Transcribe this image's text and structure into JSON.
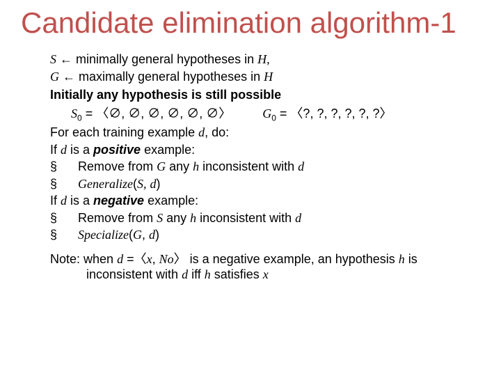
{
  "title": "Candidate elimination algorithm-1",
  "lineS": {
    "var": "S",
    "arrow": " ← ",
    "rest": "minimally general hypotheses in ",
    "H": "H,",
    "Hcomma": ""
  },
  "lineG": {
    "var": "G",
    "arrow": " ← ",
    "rest": "maximally general hypotheses in ",
    "H": "H"
  },
  "init": "Initially any hypothesis is still possible",
  "s0": {
    "label": "S",
    "sub": "0",
    "eq": " = 〈∅, ∅, ∅, ∅, ∅, ∅〉"
  },
  "g0": {
    "label": "G",
    "sub": "0",
    "eq": " = 〈?, ?, ?, ?, ?, ?〉"
  },
  "foreach": {
    "a": "For each training example ",
    "d": "d",
    "b": ", do:"
  },
  "ifpos": {
    "a": "If ",
    "d": "d",
    "b": " is a ",
    "kind": "positive",
    "c": " example:"
  },
  "pos_remove": {
    "bullet": "§",
    "a": "Remove from ",
    "G": "G",
    "b": " any ",
    "h": "h",
    "c": " inconsistent with ",
    "d": "d"
  },
  "pos_gen": {
    "bullet": "§",
    "fn": "Generalize",
    "args_open": "(",
    "S": "S,",
    "sp": " ",
    "d": "d",
    "args_close": ")"
  },
  "ifneg": {
    "a": "If ",
    "d": "d",
    "b": " is a ",
    "kind": "negative",
    "c": " example:"
  },
  "neg_remove": {
    "bullet": "§",
    "a": "Remove from ",
    "S": "S",
    "b": " any ",
    "h": "h",
    "c": " inconsistent with ",
    "d": "d"
  },
  "neg_spec": {
    "bullet": "§",
    "fn": "Specialize",
    "args_open": "(",
    "G": "G",
    "comma": ", ",
    "d": "d",
    "args_close": ")"
  },
  "note": {
    "a": "Note: when ",
    "d": "d",
    "eq": " =〈",
    "x": "x",
    "comma": ", ",
    "No": "No",
    "close": "〉 is a negative example, an hypothesis ",
    "h": "h",
    "mid": " is inconsistent with ",
    "d2": "d",
    "iff": " iff ",
    "h2": "h",
    "sat": " satisfies ",
    "x2": "x"
  }
}
